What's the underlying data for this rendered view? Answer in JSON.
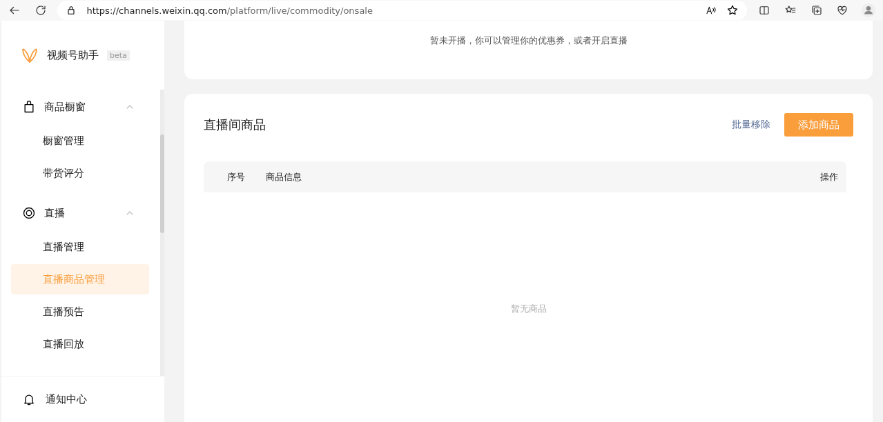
{
  "browser": {
    "url_host": "https://channels.weixin.qq.com",
    "url_path": "/platform/live/commodity/onsale"
  },
  "sidebar": {
    "brand": "视频号助手",
    "badge": "beta",
    "groups": [
      {
        "kind": "bag",
        "label": "商品橱窗",
        "expanded": true,
        "children": [
          {
            "label": "橱窗管理",
            "selected": false
          },
          {
            "label": "带货评分",
            "selected": false
          }
        ]
      },
      {
        "kind": "live",
        "label": "直播",
        "expanded": true,
        "children": [
          {
            "label": "直播管理",
            "selected": false
          },
          {
            "label": "直播商品管理",
            "selected": true
          },
          {
            "label": "直播预告",
            "selected": false
          },
          {
            "label": "直播回放",
            "selected": false
          }
        ]
      }
    ],
    "footer_item": {
      "label": "通知中心"
    }
  },
  "notice": "暂未开播，你可以管理你的优惠券，或者开启直播",
  "products": {
    "title": "直播间商品",
    "remove_link": "批量移除",
    "add_button": "添加商品",
    "columns": [
      "序号",
      "商品信息",
      "操作"
    ],
    "empty": "暂无商品"
  }
}
